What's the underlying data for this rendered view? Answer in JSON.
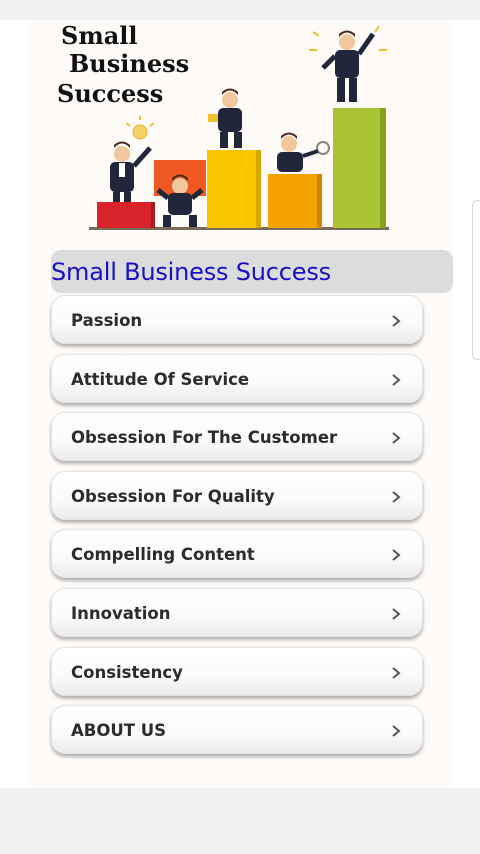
{
  "banner": {
    "title_line1": "Small",
    "title_line2": "Business",
    "title_line3": "Success"
  },
  "header": {
    "title": "Small Business Success"
  },
  "menu": {
    "items": [
      {
        "label": "Passion",
        "icon": "chevron-right-icon"
      },
      {
        "label": "Attitude Of Service",
        "icon": "chevron-right-icon"
      },
      {
        "label": "Obsession For The Customer",
        "icon": "chevron-right-icon"
      },
      {
        "label": "Obsession For Quality",
        "icon": "chevron-right-icon"
      },
      {
        "label": "Compelling Content",
        "icon": "chevron-right-icon"
      },
      {
        "label": "Innovation",
        "icon": "chevron-right-icon"
      },
      {
        "label": "Consistency",
        "icon": "chevron-right-icon"
      },
      {
        "label": "ABOUT US",
        "icon": "chevron-right-icon"
      }
    ]
  },
  "colors": {
    "header_text": "#1a0fc8",
    "header_bg": "#dcdcdc",
    "bar_red": "#d9232a",
    "bar_orange": "#f05a22",
    "bar_yellow": "#f7c600",
    "bar_amber": "#f5a300",
    "bar_green": "#a9c332"
  }
}
